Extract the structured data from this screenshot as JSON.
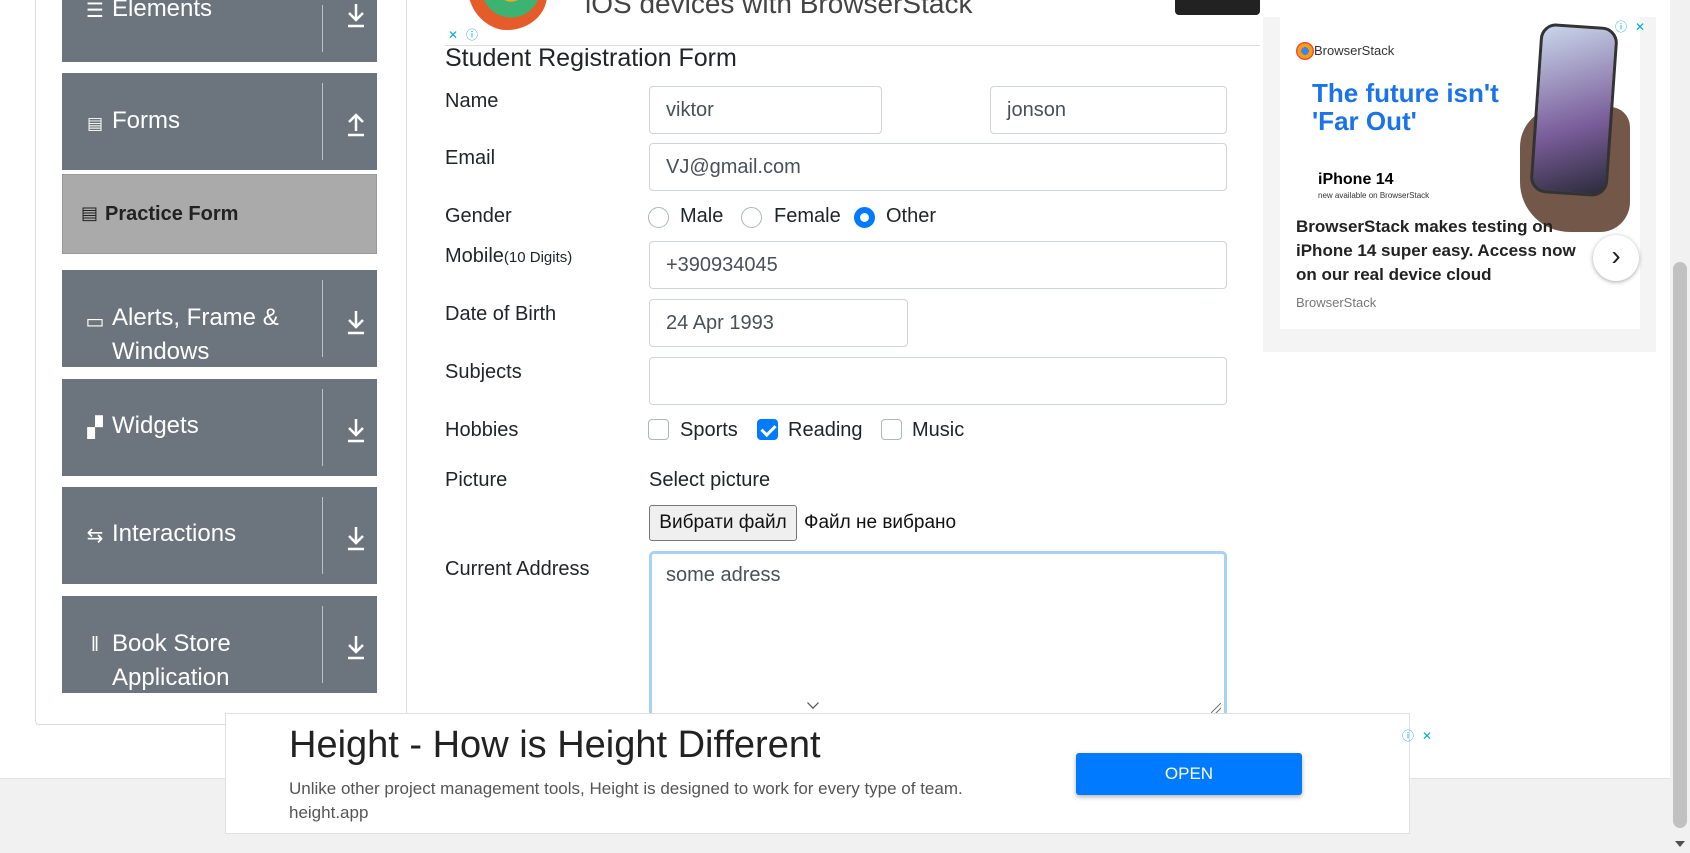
{
  "sidebar": {
    "groups": [
      {
        "title": "Elements",
        "icon": "hamburger-icon",
        "arrow": "down"
      },
      {
        "title": "Forms",
        "icon": "form-icon",
        "arrow": "up"
      },
      {
        "title": "Alerts, Frame & Windows",
        "icon": "window-icon",
        "arrow": "down"
      },
      {
        "title": "Widgets",
        "icon": "widgets-icon",
        "arrow": "down"
      },
      {
        "title": "Interactions",
        "icon": "interactions-icon",
        "arrow": "down"
      },
      {
        "title": "Book Store Application",
        "icon": "books-icon",
        "arrow": "down"
      }
    ],
    "active_item": "Practice Form"
  },
  "top_ad": {
    "text": "iOS devices with BrowserStack"
  },
  "form": {
    "title": "Student Registration Form",
    "labels": {
      "name": "Name",
      "email": "Email",
      "gender": "Gender",
      "mobile": "Mobile",
      "mobile_hint": "(10 Digits)",
      "dob": "Date of Birth",
      "subjects": "Subjects",
      "hobbies": "Hobbies",
      "picture": "Picture",
      "address": "Current Address"
    },
    "first_name": "viktor",
    "last_name": "jonson",
    "email": "VJ@gmail.com",
    "gender_options": [
      "Male",
      "Female",
      "Other"
    ],
    "gender_selected": "Other",
    "mobile": "+390934045",
    "dob": "24 Apr 1993",
    "subjects": "",
    "hobbies": [
      {
        "label": "Sports",
        "checked": false
      },
      {
        "label": "Reading",
        "checked": true
      },
      {
        "label": "Music",
        "checked": false
      }
    ],
    "picture_prompt": "Select picture",
    "file_button": "Вибрати файл",
    "file_status": "Файл не вибрано",
    "address": "some adress"
  },
  "right_ad": {
    "brand": "BrowserStack",
    "headline": "The future isn't 'Far Out'",
    "product": "iPhone 14",
    "product_sub": "new available on BrowserStack",
    "body": "BrowserStack makes testing on iPhone 14 super easy. Access now on our real device cloud",
    "source": "BrowserStack"
  },
  "bottom_ad": {
    "headline": "Height - How is Height Different",
    "description": "Unlike other project management tools, Height is designed to work for every type of team. height.app",
    "button": "OPEN"
  },
  "colors": {
    "accent": "#007bff",
    "sidebar": "#6c757d",
    "active_item": "#aaaaaa",
    "ad_headline": "#1a73e8"
  }
}
